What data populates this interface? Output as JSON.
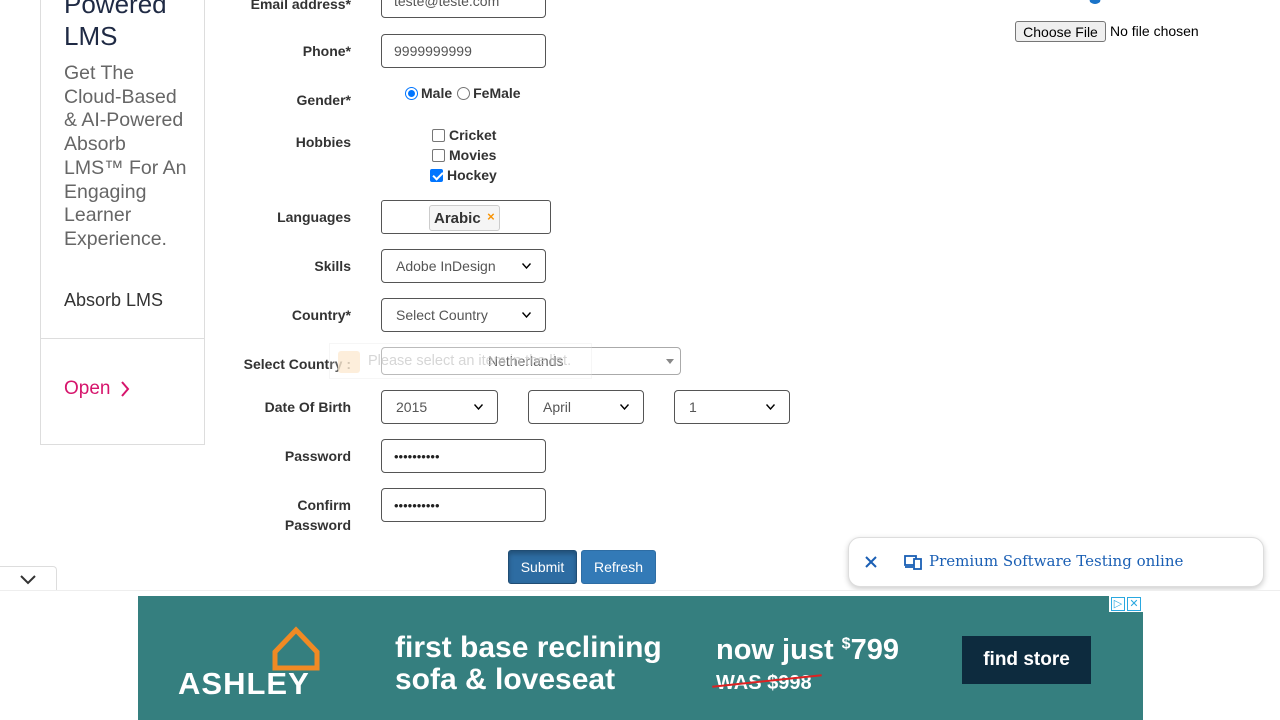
{
  "side_ad": {
    "headline": "Powered LMS",
    "body": "Get The Cloud-Based & AI-Powered Absorb LMS™ For An Engaging Learner Experience.",
    "brand": "Absorb LMS",
    "open_label": "Open"
  },
  "form": {
    "email": {
      "label": "Email address*",
      "value": "teste@teste.com"
    },
    "phone": {
      "label": "Phone*",
      "value": "9999999999"
    },
    "gender": {
      "label": "Gender*",
      "options": [
        "Male",
        "FeMale"
      ],
      "selected": "Male"
    },
    "hobbies": {
      "label": "Hobbies",
      "items": [
        {
          "label": "Cricket",
          "checked": false
        },
        {
          "label": "Movies",
          "checked": false
        },
        {
          "label": "Hockey",
          "checked": true
        }
      ]
    },
    "languages": {
      "label": "Languages",
      "chip": "Arabic",
      "chip_remove": "×"
    },
    "skills": {
      "label": "Skills",
      "value": "Adobe InDesign"
    },
    "country": {
      "label": "Country*",
      "value": "Select Country"
    },
    "select_country": {
      "label": "Select Country :",
      "value": "Netherlands",
      "tooltip": "Please select an item in the list."
    },
    "dob": {
      "label": "Date Of Birth",
      "year": "2015",
      "month": "April",
      "day": "1"
    },
    "password": {
      "label": "Password",
      "value": "••••••••••"
    },
    "confirm_password": {
      "label_line1": "Confirm",
      "label_line2": "Password",
      "value": "••••••••••"
    },
    "submit_label": "Submit",
    "refresh_label": "Refresh"
  },
  "file_upload": {
    "button_label": "Choose File",
    "status": "No file chosen"
  },
  "pill": {
    "text": "Premium Software Testing online"
  },
  "banner": {
    "logo": "ASHLEY",
    "tagline_line1": "first base reclining",
    "tagline_line2": "sofa & loveseat",
    "price_prefix": "now just ",
    "price_symbol": "$",
    "price": "799",
    "was": "WAS $998",
    "cta": "find store"
  },
  "colors": {
    "primary": "#337ab7",
    "banner_bg": "#357f7f",
    "ad_accent": "#d6156c",
    "pill_text": "#1a5fb4"
  }
}
